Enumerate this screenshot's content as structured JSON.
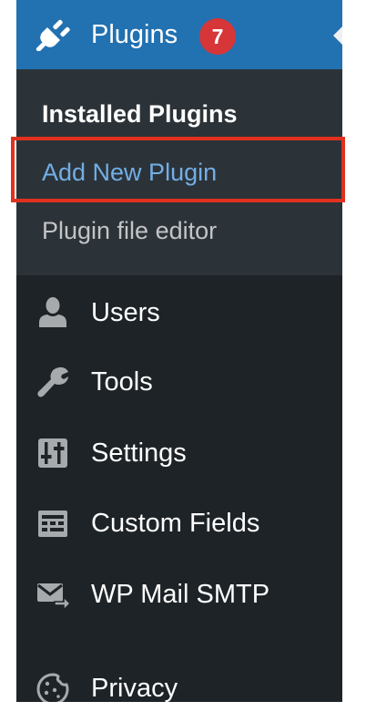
{
  "menu": {
    "active": {
      "label": "Plugins",
      "icon": "plugin-icon",
      "badge": "7"
    },
    "submenu": [
      {
        "label": "Installed Plugins",
        "state": "current"
      },
      {
        "label": "Add New Plugin",
        "state": "highlighted"
      },
      {
        "label": "Plugin file editor",
        "state": "normal"
      }
    ],
    "items": [
      {
        "label": "Users",
        "icon": "user-icon"
      },
      {
        "label": "Tools",
        "icon": "wrench-icon"
      },
      {
        "label": "Settings",
        "icon": "settings-sliders-icon"
      },
      {
        "label": "Custom Fields",
        "icon": "custom-fields-icon"
      },
      {
        "label": "WP Mail SMTP",
        "icon": "mail-send-icon"
      },
      {
        "label": "Privacy",
        "icon": "cookie-icon"
      }
    ]
  },
  "colors": {
    "menu_bg": "#1d2327",
    "submenu_bg": "#2c3338",
    "active_bg": "#2271b1",
    "link_blue": "#72aee6",
    "badge_red": "#d63638",
    "annotation_red": "#e0311f"
  }
}
